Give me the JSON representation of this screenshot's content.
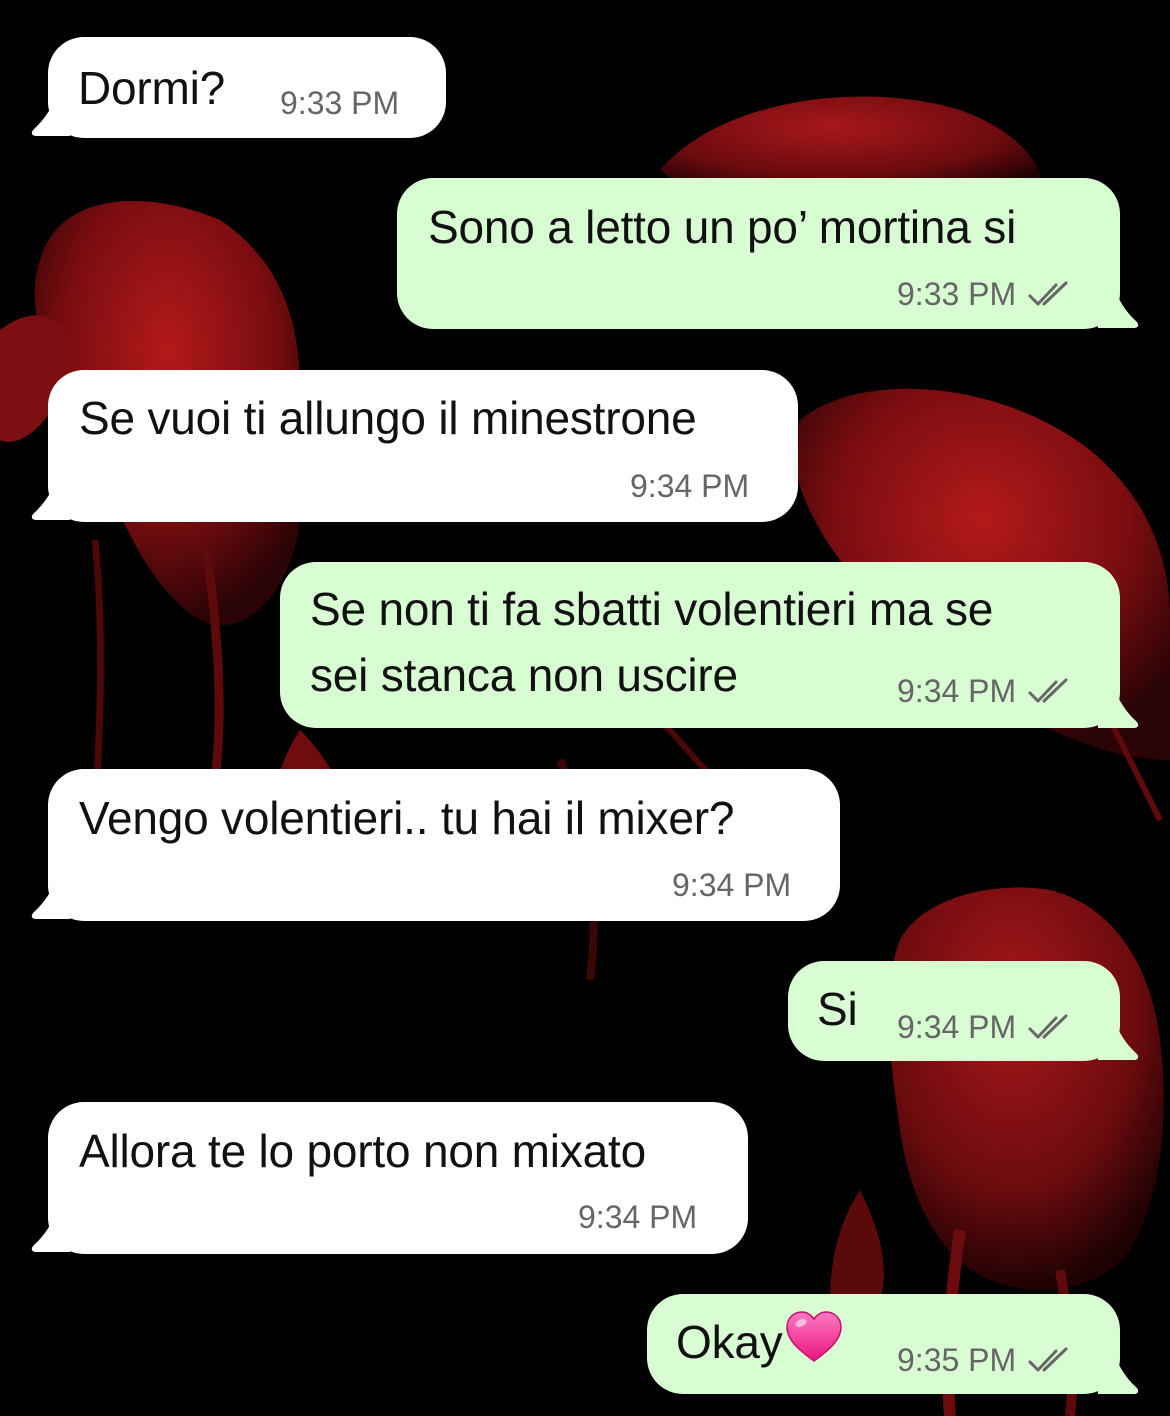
{
  "conversation": {
    "messages": [
      {
        "direction": "incoming",
        "text": "Dormi?",
        "time": "9:33 PM"
      },
      {
        "direction": "outgoing",
        "text": "Sono a letto un po’ mortina si",
        "time": "9:33 PM",
        "status_icon": "double-check-icon"
      },
      {
        "direction": "incoming",
        "text": "Se vuoi ti allungo il minestrone",
        "time": "9:34 PM"
      },
      {
        "direction": "outgoing",
        "lines": [
          "Se non ti fa sbatti volentieri ma se",
          "sei stanca non uscire"
        ],
        "time": "9:34 PM",
        "status_icon": "double-check-icon"
      },
      {
        "direction": "incoming",
        "text": "Vengo volentieri.. tu hai il mixer?",
        "time": "9:34 PM"
      },
      {
        "direction": "outgoing",
        "text": "Si",
        "time": "9:34 PM",
        "status_icon": "double-check-icon"
      },
      {
        "direction": "incoming",
        "text": "Allora te lo porto non mixato",
        "time": "9:34 PM"
      },
      {
        "direction": "outgoing",
        "text": "Okay",
        "emoji": "pink-heart-emoji",
        "time": "9:35 PM",
        "status_icon": "double-check-icon"
      }
    ]
  },
  "colors": {
    "incoming_bubble": "#ffffff",
    "outgoing_bubble": "#d9fdd3",
    "background": "#000000",
    "wallpaper_accent": "#8f1214",
    "timestamp": "#666666",
    "heart": "#ff4fa3"
  }
}
